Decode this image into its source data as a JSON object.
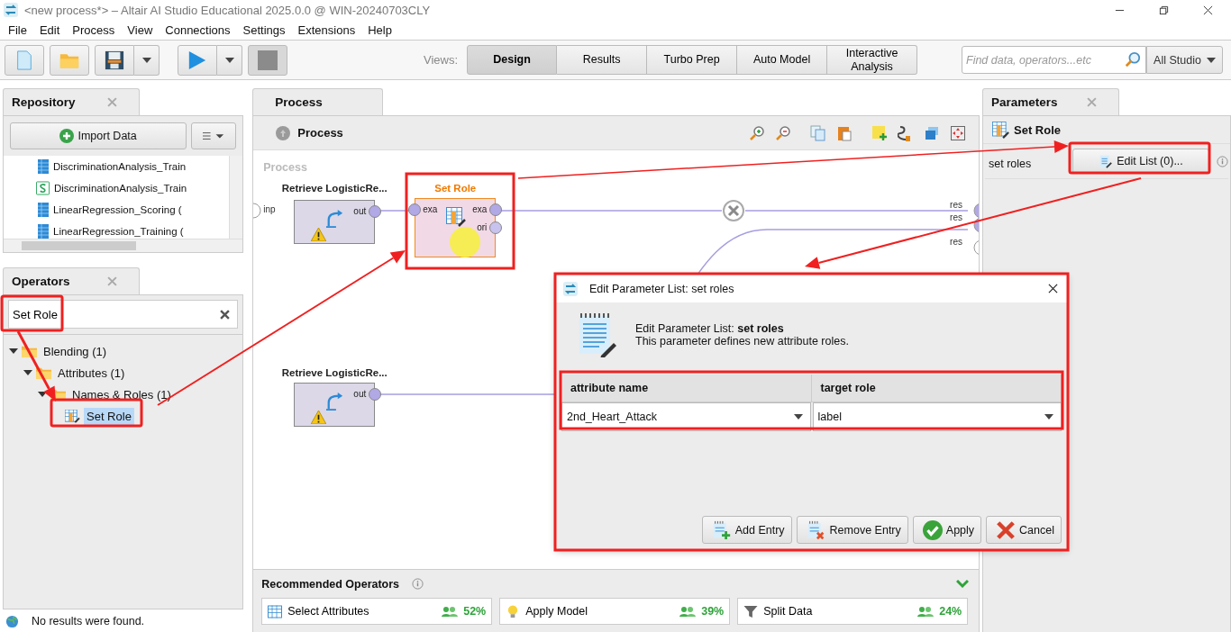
{
  "window": {
    "title": "<new process*> – Altair AI Studio Educational 2025.0.0 @ WIN-20240703CLY"
  },
  "menu": [
    "File",
    "Edit",
    "Process",
    "View",
    "Connections",
    "Settings",
    "Extensions",
    "Help"
  ],
  "views": {
    "label": "Views:",
    "tabs": [
      {
        "label": "Design",
        "selected": true
      },
      {
        "label": "Results",
        "selected": false
      },
      {
        "label": "Turbo Prep",
        "selected": false
      },
      {
        "label": "Auto Model",
        "selected": false
      },
      {
        "label": "Interactive Analysis",
        "selected": false
      }
    ]
  },
  "search": {
    "placeholder": "Find data, operators...etc",
    "scope": "All Studio"
  },
  "repository": {
    "title": "Repository",
    "import_button": "Import Data",
    "items": [
      {
        "name": "DiscriminationAnalysis_Train",
        "kind": "data"
      },
      {
        "name": "DiscriminationAnalysis_Train",
        "kind": "script"
      },
      {
        "name": "LinearRegression_Scoring (",
        "kind": "data"
      },
      {
        "name": "LinearRegression_Training (",
        "kind": "data"
      }
    ]
  },
  "operators": {
    "title": "Operators",
    "search_value": "Set Role",
    "tree": [
      {
        "label": "Blending (1)",
        "expanded": true,
        "children": [
          {
            "label": "Attributes (1)",
            "expanded": true,
            "children": [
              {
                "label": "Names & Roles (1)",
                "expanded": true,
                "children": [
                  {
                    "label": "Set Role",
                    "selected": true
                  }
                ]
              }
            ]
          }
        ]
      }
    ],
    "status": "No results were found."
  },
  "process": {
    "tab": "Process",
    "breadcrumb": "Process",
    "canvas_label": "Process",
    "input_ports": [
      "inp"
    ],
    "result_ports": [
      "res",
      "res",
      "res"
    ],
    "nodes": [
      {
        "name": "Retrieve LogisticRe...",
        "kind": "retrieve",
        "selected": false,
        "warning": true,
        "out_ports": [
          "out"
        ]
      },
      {
        "name": "Set Role",
        "kind": "set_role",
        "selected": true,
        "warning": false,
        "in_ports": [
          "exa"
        ],
        "out_ports": [
          "exa",
          "ori"
        ]
      },
      {
        "name": "Retrieve LogisticRe...",
        "kind": "retrieve",
        "selected": false,
        "warning": true,
        "out_ports": [
          "out"
        ]
      }
    ]
  },
  "recommended": {
    "title": "Recommended Operators",
    "items": [
      {
        "name": "Select Attributes",
        "kind": "select",
        "percent": "52%"
      },
      {
        "name": "Apply Model",
        "kind": "apply",
        "percent": "39%"
      },
      {
        "name": "Split Data",
        "kind": "split",
        "percent": "24%"
      }
    ]
  },
  "parameters": {
    "title": "Parameters",
    "operator": "Set Role",
    "rows": [
      {
        "label": "set roles",
        "button": "Edit List (0)..."
      }
    ]
  },
  "dialog": {
    "title": "Edit Parameter List: set roles",
    "heading": "Edit Parameter List: **set roles**",
    "description": "This parameter defines new attribute roles.",
    "columns": [
      "attribute name",
      "target role"
    ],
    "rows": [
      [
        "2nd_Heart_Attack",
        "label"
      ]
    ],
    "buttons": [
      {
        "label": "Add Entry",
        "kind": "add"
      },
      {
        "label": "Remove Entry",
        "kind": "remove"
      },
      {
        "label": "Apply",
        "kind": "apply"
      },
      {
        "label": "Cancel",
        "kind": "cancel"
      }
    ]
  }
}
